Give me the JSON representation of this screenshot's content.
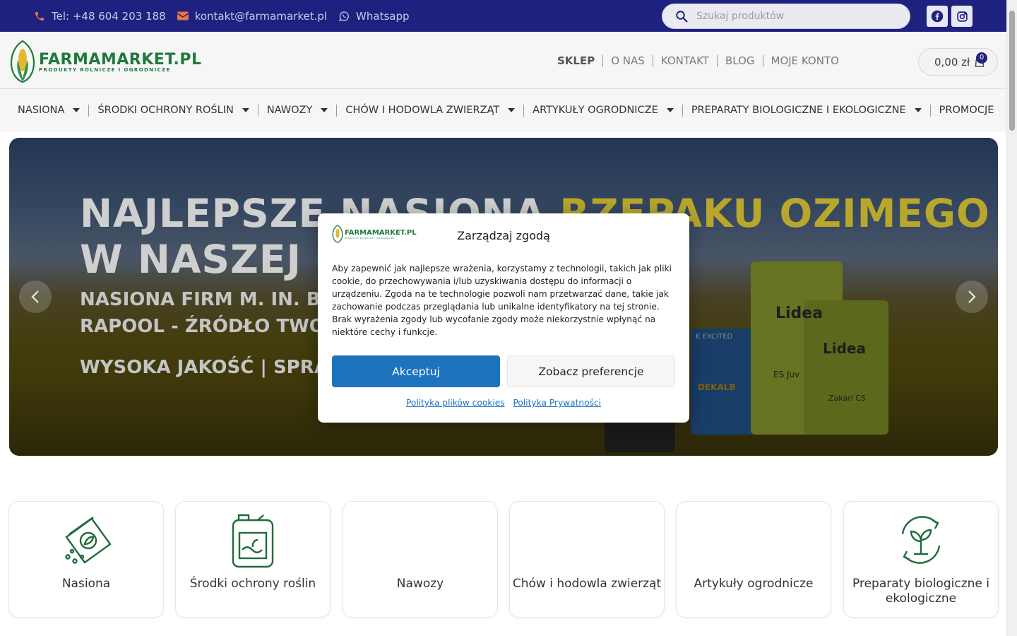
{
  "topbar": {
    "phone": "Tel: +48 604 203 188",
    "email": "kontakt@farmamarket.pl",
    "whatsapp": "Whatsapp",
    "search_placeholder": "Szukaj produktów"
  },
  "header": {
    "logo_title": "FARMAMARKET.PL",
    "logo_subtitle": "PRODUKTY ROLNICZE I OGRODNICZE",
    "nav": [
      "SKLEP",
      "O NAS",
      "KONTAKT",
      "BLOG",
      "MOJE KONTO"
    ],
    "cart_total": "0,00 zł",
    "cart_count": "0"
  },
  "categories": [
    "NASIONA",
    "ŚRODKI OCHRONY ROŚLIN",
    "NAWOZY",
    "CHÓW I HODOWLA ZWIERZĄT",
    "ARTYKUŁY OGRODNICZE",
    "PREPARATY BIOLOGICZNE I EKOLOGICZNE",
    "PROMOCJE"
  ],
  "hero": {
    "line1_a": "NAJLEPSZE NASIONA ",
    "line1_b": "RZEPAKU OZIMEGO",
    "line2": "W NASZEJ O",
    "line3": "NASIONA FIRM M. IN. BA",
    "line4": "RAPOOL - ŹRÓDŁO TWOJE",
    "line5": "WYSOKA JAKOŚĆ | SPRAW",
    "bag1": "Lidea",
    "bag2": "ES Juv",
    "bag3": "Lidea",
    "bag4": "Zakari CS",
    "bag5": "DEKALB",
    "bag6": "K EXCITED"
  },
  "cards": [
    "Nasiona",
    "Środki ochrony roślin",
    "Nawozy",
    "Chów i hodowla zwierząt",
    "Artykuły ogrodnicze",
    "Preparaty biologiczne i ekologiczne"
  ],
  "consent": {
    "logo_title": "FARMAMARKET.PL",
    "title": "Zarządzaj zgodą",
    "text": "Aby zapewnić jak najlepsze wrażenia, korzystamy z technologii, takich jak pliki cookie, do przechowywania i/lub uzyskiwania dostępu do informacji o urządzeniu. Zgoda na te technologie pozwoli nam przetwarzać dane, takie jak zachowanie podczas przeglądania lub unikalne identyfikatory na tej stronie. Brak wyrażenia zgody lub wycofanie zgody może niekorzystnie wpłynąć na niektóre cechy i funkcje.",
    "accept": "Akceptuj",
    "preferences": "Zobacz preferencje",
    "cookie_policy": "Polityka plików cookies",
    "privacy_policy": "Polityka Prywatności"
  },
  "colors": {
    "topbar": "#1f2180",
    "accent_orange": "#e8743f",
    "brand_green": "#1f7a3d",
    "accept_blue": "#1e73be"
  }
}
